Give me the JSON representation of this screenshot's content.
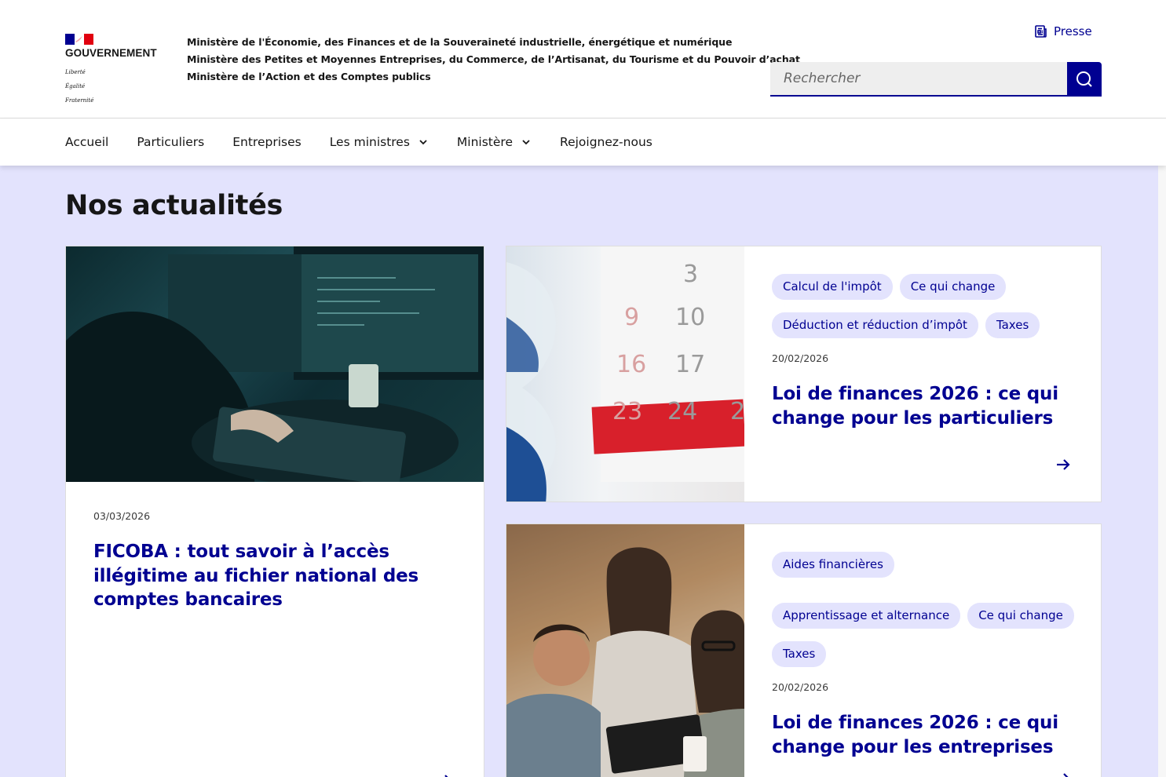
{
  "header": {
    "logo": {
      "brand": "GOUVERNEMENT",
      "motto": [
        "Liberté",
        "Égalité",
        "Fraternité"
      ],
      "flag_colors": [
        "#000091",
        "#ffffff",
        "#e1000f"
      ]
    },
    "ministries": [
      "Ministère de l'Économie, des Finances et de la Souveraineté industrielle, énergétique et numérique",
      "Ministère des Petites et Moyennes Entreprises, du Commerce, de l’Artisanat, du Tourisme et du Pouvoir d’achat",
      "Ministère de l’Action et des Comptes publics"
    ],
    "presse": {
      "label": "Presse",
      "icon": "newspaper-icon"
    },
    "search": {
      "placeholder": "Rechercher",
      "value": "",
      "icon": "search-icon"
    }
  },
  "nav": {
    "items": [
      {
        "label": "Accueil",
        "has_dropdown": false
      },
      {
        "label": "Particuliers",
        "has_dropdown": false
      },
      {
        "label": "Entreprises",
        "has_dropdown": false
      },
      {
        "label": "Les ministres",
        "has_dropdown": true
      },
      {
        "label": "Ministère",
        "has_dropdown": true
      },
      {
        "label": "Rejoignez-nous",
        "has_dropdown": false
      }
    ]
  },
  "main": {
    "section_title": "Nos actualités",
    "cards": [
      {
        "image": "person-typing-computer-photo",
        "tags": [],
        "date": "03/03/2026",
        "title": "FICOBA : tout savoir à l’accès illégitime au fichier national des comptes bancaires"
      },
      {
        "image": "hourglass-calendar-photo",
        "tags": [
          "Calcul de l'impôt",
          "Ce qui change",
          "Déduction et réduction d’impôt",
          "Taxes"
        ],
        "date": "20/02/2026",
        "title": "Loi de finances 2026 : ce qui change pour les particuliers"
      },
      {
        "image": "team-meeting-photo",
        "tags": [
          "Aides financières",
          "Apprentissage et alternance",
          "Ce qui change",
          "Taxes"
        ],
        "date": "20/02/2026",
        "title": "Loi de finances 2026 : ce qui change pour les entreprises"
      }
    ]
  },
  "colors": {
    "primary": "#000091",
    "background_section": "#e3e3fd",
    "tag_background": "#e3e3fd",
    "text": "#161616"
  }
}
